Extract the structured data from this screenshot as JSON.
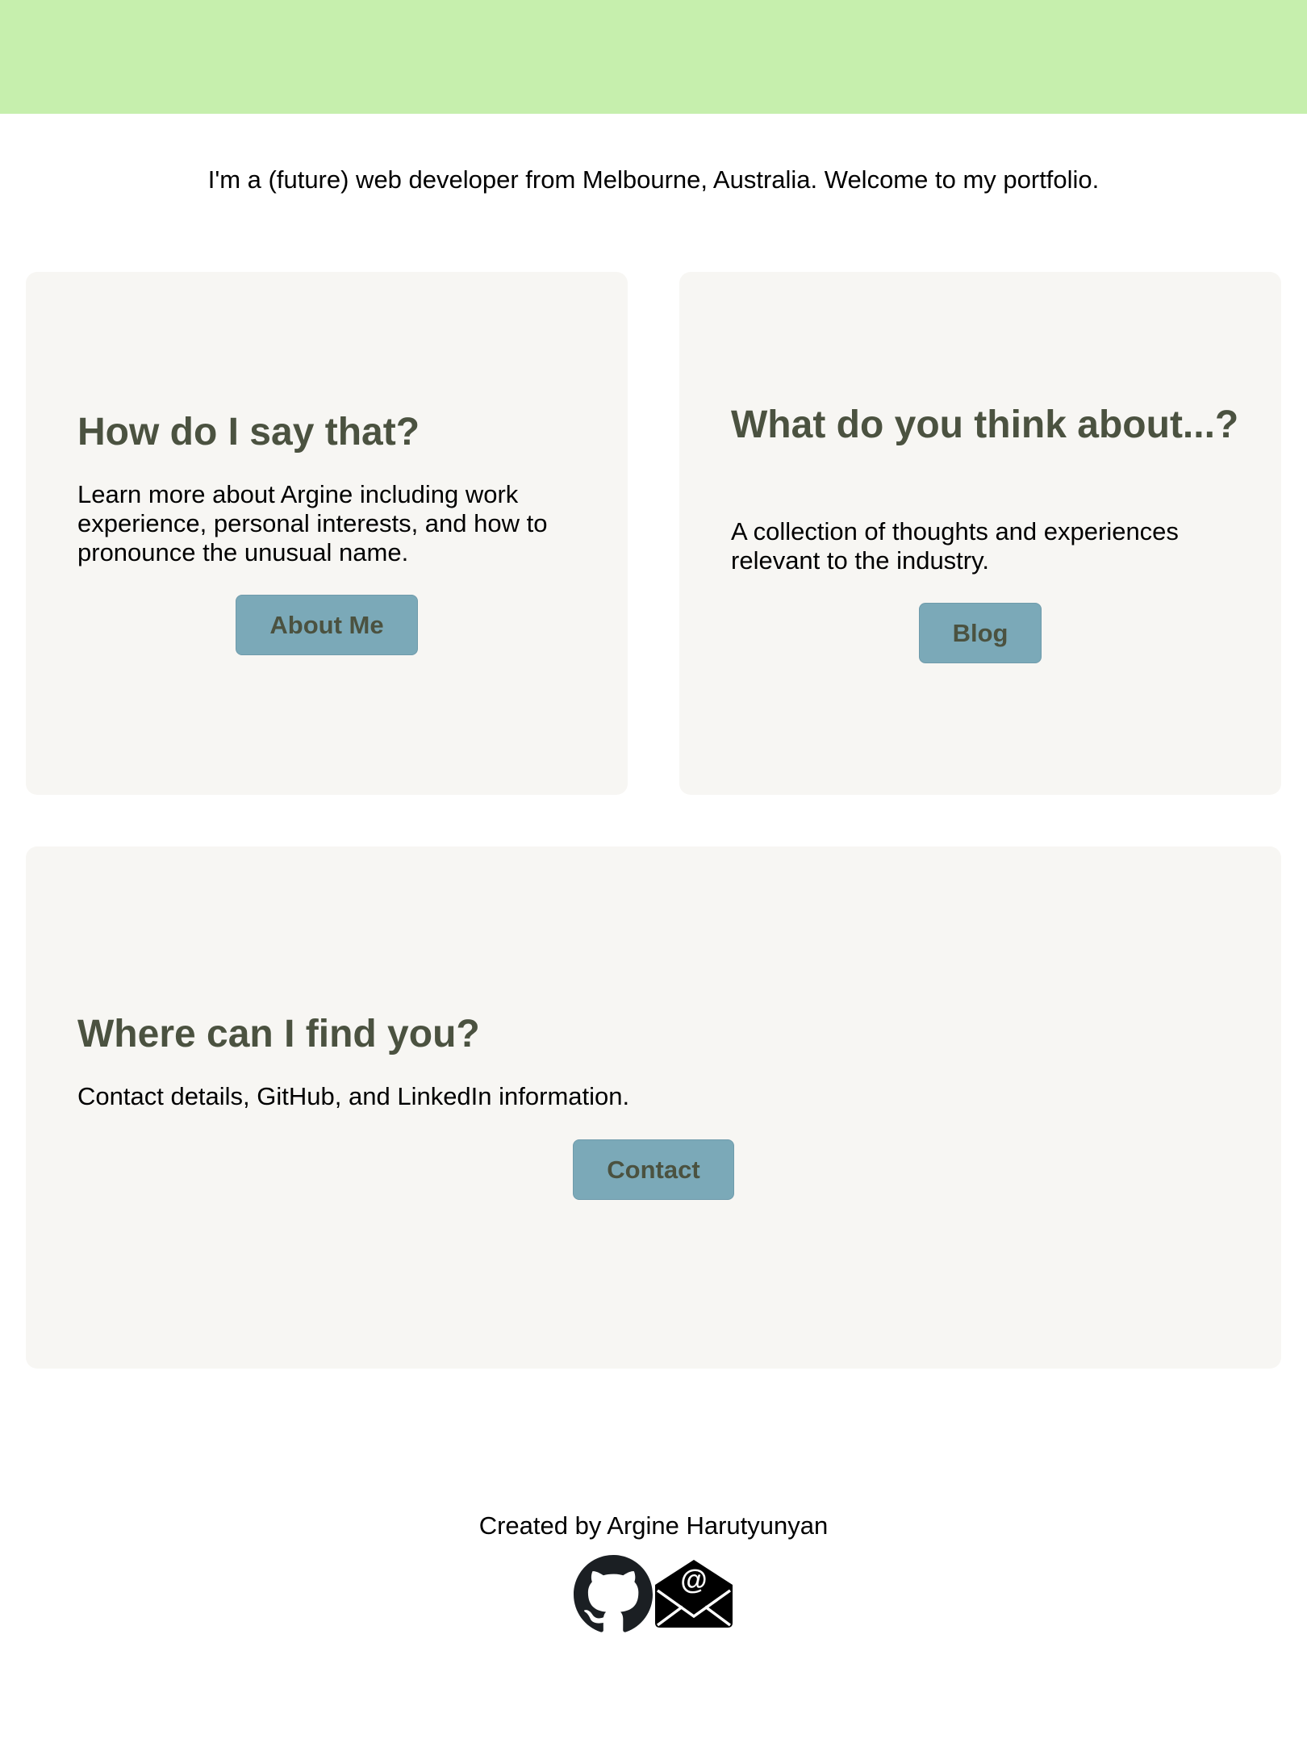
{
  "intro": {
    "text": "I'm a (future) web developer from Melbourne, Australia. Welcome to my portfolio."
  },
  "cards": {
    "about": {
      "heading": "How do I say that?",
      "text": "Learn more about Argine including work experience, personal interests, and how to pronounce the unusual name.",
      "button_label": "About Me"
    },
    "blog": {
      "heading": "What do you think about...?",
      "text": "A collection of thoughts and experiences relevant to the industry.",
      "button_label": "Blog"
    },
    "contact": {
      "heading": "Where can I find you?",
      "text": "Contact details, GitHub, and LinkedIn information.",
      "button_label": "Contact"
    }
  },
  "footer": {
    "credit": "Created by Argine Harutyunyan",
    "icons": [
      "github-icon",
      "email-icon"
    ]
  },
  "colors": {
    "banner": "#c6efad",
    "card_background": "#f7f6f3",
    "heading": "#4b5240",
    "button_background": "#7ba9b8"
  }
}
